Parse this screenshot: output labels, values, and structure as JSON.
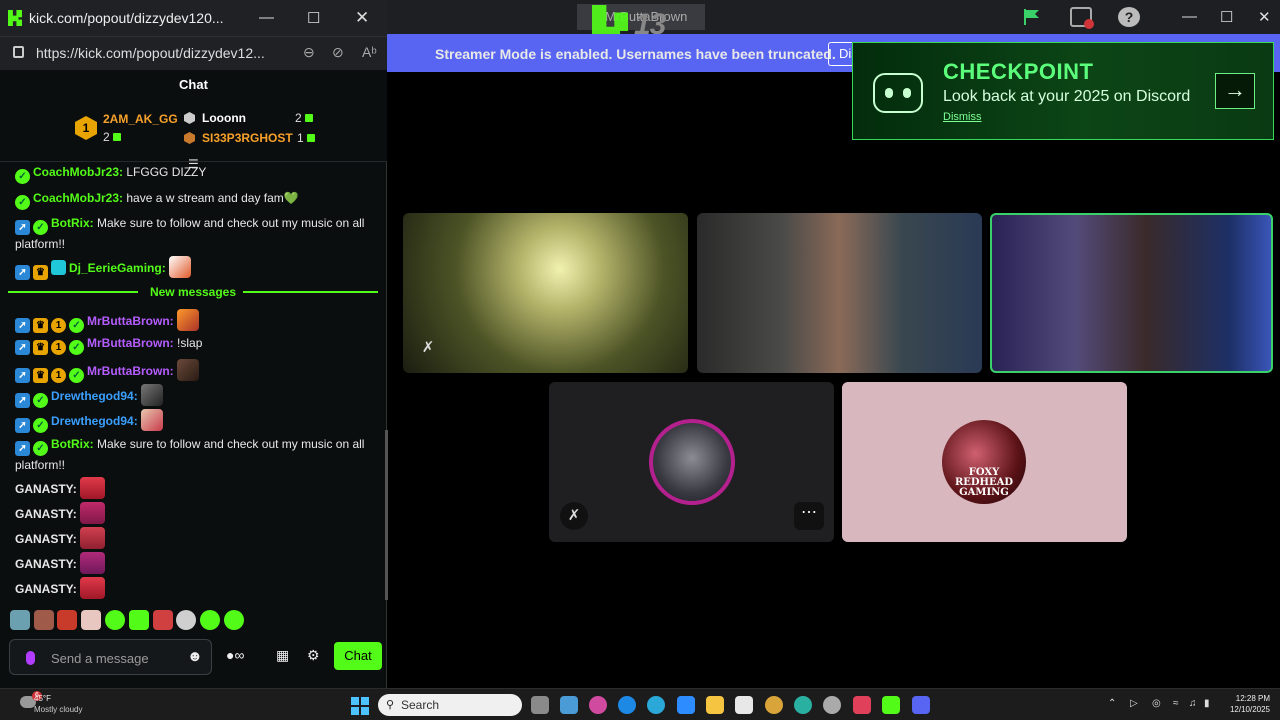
{
  "colors": {
    "kick_green": "#53fc18",
    "discord_blurple": "#5865f2",
    "checkpoint_green": "#5cff7b"
  },
  "discord": {
    "tab_label": "MrButtaBrown",
    "overlay_text": "13",
    "streamer_banner": "Streamer Mode is enabled. Usernames have been truncated.",
    "dismiss_button": "Dis",
    "checkpoint": {
      "title": "CHECKPOINT",
      "subtitle": "Look back at your 2025 on Discord",
      "dismiss": "Dismiss",
      "icon": "arrow-right-icon"
    },
    "tiles": [
      {
        "label": "video-tile-1",
        "muted": true
      },
      {
        "label": "video-tile-2",
        "muted": false
      },
      {
        "label": "video-tile-3",
        "speaking": true
      },
      {
        "label": "avatar-tile-4",
        "muted": true
      },
      {
        "label": "avatar-tile-5",
        "avatar_text": "FOXY REDHEAD GAMING"
      }
    ]
  },
  "kick": {
    "window_title": "kick.com/popout/dizzydev120...",
    "url": "https://kick.com/popout/dizzydev12...",
    "chat_title": "Chat",
    "leaderboard": [
      {
        "rank": "1",
        "name": "2AM_AK_GG",
        "count": "2",
        "color": "#f7a12b"
      },
      {
        "name": "Looonn",
        "count": "2",
        "color": "#ffffff"
      },
      {
        "name": "SI33P3RGHOST",
        "count": "1",
        "color": "#f7a12b"
      }
    ],
    "messages": [
      {
        "user": "CoachMobJr23",
        "text": "LFGGG DIZZY",
        "color": "#53fc18"
      },
      {
        "user": "CoachMobJr23",
        "text": "have a w stream and day fam💚",
        "color": "#53fc18"
      },
      {
        "user": "BotRix",
        "text": "Make sure to follow and check out my music on all platform!!",
        "color": "#53fc18"
      },
      {
        "user": "Dj_EerieGaming",
        "text": "",
        "color": "#53fc18"
      },
      {
        "user": "MrButtaBrown",
        "text": "",
        "color": "#b55dff"
      },
      {
        "user": "MrButtaBrown",
        "text": "!slap",
        "color": "#b55dff"
      },
      {
        "user": "MrButtaBrown",
        "text": "",
        "color": "#b55dff"
      },
      {
        "user": "Drewthegod94",
        "text": "",
        "color": "#3aa0ff"
      },
      {
        "user": "Drewthegod94",
        "text": "",
        "color": "#3aa0ff"
      },
      {
        "user": "BotRix",
        "text": "Make sure to follow and check out my music on all platform!!",
        "color": "#53fc18"
      },
      {
        "user": "GANASTY",
        "text": "",
        "color": "#ffffff"
      },
      {
        "user": "GANASTY",
        "text": "",
        "color": "#ffffff"
      },
      {
        "user": "GANASTY",
        "text": "",
        "color": "#ffffff"
      },
      {
        "user": "GANASTY",
        "text": "",
        "color": "#ffffff"
      },
      {
        "user": "GANASTY",
        "text": "",
        "color": "#ffffff"
      }
    ],
    "new_messages_label": "New messages",
    "input_placeholder": "Send a message",
    "send_button": "Chat"
  },
  "taskbar": {
    "weather_temp": "45°F",
    "weather_cond": "Mostly cloudy",
    "weather_alert": "6",
    "search_label": "Search",
    "time": "12:28 PM",
    "date": "12/10/2025"
  }
}
